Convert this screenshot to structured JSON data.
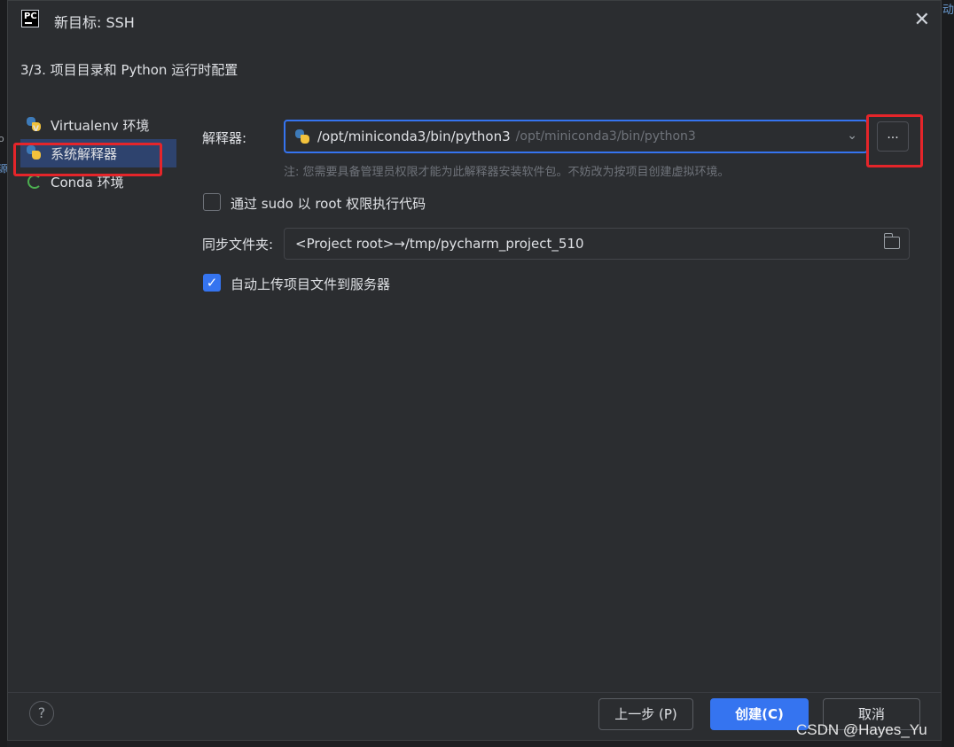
{
  "window": {
    "title": "新目标: SSH"
  },
  "step": "3/3. 项目目录和 Python 运行时配置",
  "sidebar": {
    "items": [
      {
        "label": "Virtualenv 环境",
        "icon": "virtualenv-python-icon"
      },
      {
        "label": "系统解释器",
        "icon": "python-icon"
      },
      {
        "label": "Conda 环境",
        "icon": "conda-icon"
      }
    ]
  },
  "form": {
    "interpreter_label": "解释器:",
    "interpreter_path": "/opt/miniconda3/bin/python3",
    "interpreter_path_hint": "/opt/miniconda3/bin/python3",
    "browse_label": "...",
    "note": "注: 您需要具备管理员权限才能为此解释器安装软件包。不妨改为按项目创建虚拟环境。",
    "sudo_label": "通过 sudo 以 root 权限执行代码",
    "sudo_checked": false,
    "sync_label": "同步文件夹:",
    "sync_value": "<Project root>→/tmp/pycharm_project_510",
    "upload_label": "自动上传项目文件到服务器",
    "upload_checked": true
  },
  "footer": {
    "help": "?",
    "back": "上一步 (P)",
    "create": "创建(C)",
    "cancel": "取消"
  },
  "watermark": "CSDN @Hayes_Yu",
  "colors": {
    "accent": "#3574f0",
    "highlight": "#e5252a",
    "background": "#2b2d30"
  }
}
